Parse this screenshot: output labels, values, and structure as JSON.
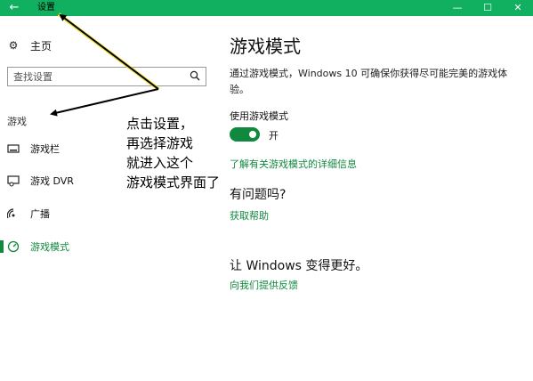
{
  "titlebar": {
    "back_icon": "back-arrow-icon",
    "title": "设置",
    "controls": [
      "minimize-icon",
      "maximize-icon",
      "close-icon"
    ],
    "accent_color": "#10b060"
  },
  "sidebar": {
    "home_label": "主页",
    "home_icon": "gear-icon",
    "search_placeholder": "查找设置",
    "search_icon": "search-icon",
    "group_header": "游戏",
    "items": [
      {
        "label": "游戏栏",
        "icon": "game-bar-icon"
      },
      {
        "label": "游戏 DVR",
        "icon": "game-dvr-icon"
      },
      {
        "label": "广播",
        "icon": "broadcast-icon"
      },
      {
        "label": "游戏模式",
        "icon": "game-mode-icon",
        "active": true
      }
    ]
  },
  "main": {
    "title": "游戏模式",
    "description": "通过游戏模式，Windows 10 可确保你获得尽可能完美的游戏体验。",
    "toggle_label": "使用游戏模式",
    "toggle_state": "开",
    "toggle_on": true,
    "learn_more_link": "了解有关游戏模式的详细信息",
    "question_heading": "有问题吗?",
    "help_link": "获取帮助",
    "feedback_heading": "让 Windows 变得更好。",
    "feedback_link": "向我们提供反馈",
    "accent_color": "#10893e"
  },
  "annotation": {
    "lines": [
      "点击设置，",
      "再选择游戏",
      "就进入这个",
      "游戏模式界面了"
    ]
  }
}
